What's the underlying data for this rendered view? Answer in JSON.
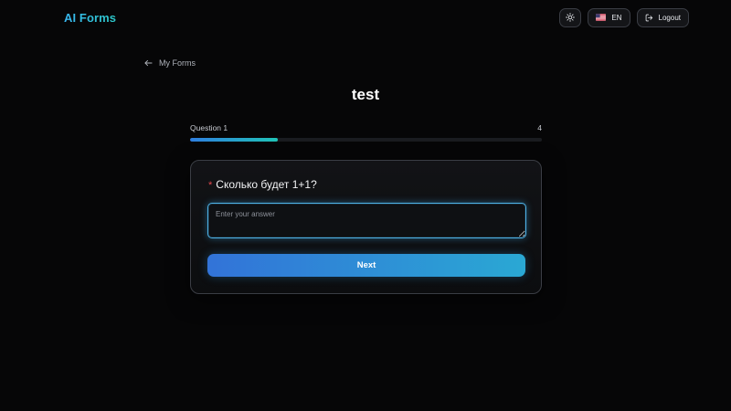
{
  "header": {
    "brand_name": "AI Forms",
    "brand_icon": "list-icon",
    "theme_icon": "sun-icon",
    "language_flag": "us-flag-icon",
    "language_label": "EN",
    "logout_icon": "logout-icon",
    "logout_label": "Logout"
  },
  "nav": {
    "back_icon": "arrow-left-icon",
    "back_label": "My Forms"
  },
  "form": {
    "title": "test",
    "progress_label": "Question 1",
    "total_questions": "4",
    "progress_fraction": 0.25
  },
  "question": {
    "required_mark": "*",
    "text": "Сколько будет 1+1?",
    "answer_value": "",
    "answer_placeholder": "Enter your answer",
    "next_label": "Next"
  },
  "colors": {
    "background": "#060607",
    "accent_start": "#3273d8",
    "accent_end": "#2aa8d4",
    "progress_start": "#2f7fe0",
    "progress_end": "#20c4b8",
    "required": "#e5484d"
  }
}
